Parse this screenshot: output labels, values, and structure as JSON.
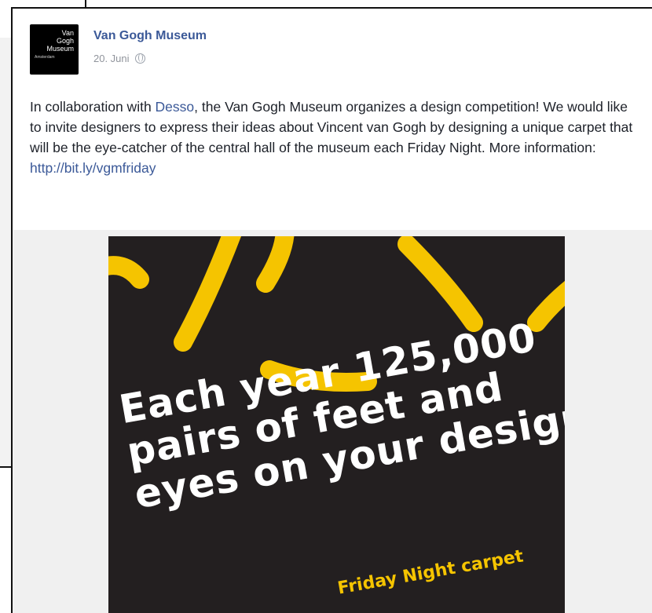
{
  "post": {
    "author": "Van Gogh Museum",
    "date": "20. Juni",
    "avatar_lines": [
      "Van",
      "Gogh",
      "Museum"
    ],
    "avatar_small": "Amsterdam",
    "text_before_link": "In collaboration with ",
    "link_desso": "Desso",
    "text_after_link": ", the Van Gogh Museum organizes a design competition! We would like to invite designers to express their ideas about Vincent van Gogh by designing a unique carpet that will be the eye-catcher of the central hall of the museum each Friday Night. More information:",
    "url": "http://bit.ly/vgmfriday"
  },
  "poster": {
    "headline_lines": [
      "Each year 125,000",
      "pairs of feet and",
      "eyes on your design?"
    ],
    "subline": "Friday Night carpet",
    "colors": {
      "background": "#231f20",
      "accent": "#f5c400",
      "text": "#ffffff"
    }
  },
  "icons": {
    "privacy": "globe-icon"
  }
}
